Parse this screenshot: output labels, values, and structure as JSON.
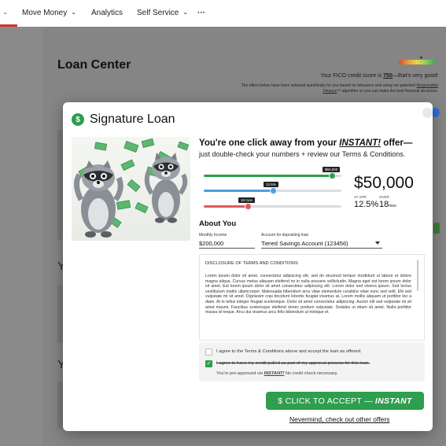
{
  "nav": {
    "items": [
      {
        "label": "Move Money"
      },
      {
        "label": "Analytics"
      },
      {
        "label": "Self Service"
      },
      {
        "label": "···"
      }
    ]
  },
  "background": {
    "page_title": "Loan Center",
    "fico_prefix": "Your FICO credit score is ",
    "fico_score": "750",
    "fico_suffix": "—that's very good!",
    "offer_note_1": "The offers below have been selected specifically for you based on relevance and using our",
    "offer_note_2": "patented",
    "offer_note_link": "Responsible Finance",
    "offer_note_3": "™ algorithm so you can make the best financial decisions.",
    "letter_1": "Y",
    "letter_2": "Y"
  },
  "modal": {
    "title": "Signature Loan",
    "headline_1": "You're one click away from your ",
    "headline_instant": "INSTANT!",
    "headline_2": " offer—",
    "subhead": "just double-check your numbers + review our Terms & Conditions.",
    "sliders": {
      "amount_tip": "$50,000",
      "apr_tip": "12.5%",
      "term_tip": "18 mos",
      "amount_level": 0.93,
      "apr_level": 0.5,
      "term_level": 0.32
    },
    "amount": "$50,000",
    "apr_label": "AT APR",
    "over_label": "OVER",
    "apr_value": "12.5%",
    "term_value": "18",
    "term_unit": "mos",
    "about_heading": "About You",
    "income_label": "Monthly Income",
    "income_value": "$200,000",
    "account_label": "Account for depositing loan",
    "account_value": "Tiered Savings Account (123456)",
    "terms_heading": "DISCLOSURE OF TERMS AND CONDITIONS",
    "terms_body": "Lorem ipsum dolor sit amet, consectetur adipiscing elit, sed do eiusmod tempor incididunt ut labore et dolore magna aliqua. Cursus metus aliquam eleifend mi in nulla posuere sollicitudin. Magna eget est lorem ipsum dolor sit amet. Est lorem ipsum dolor sit amet consectetur adipiscing elit. Lorem dolor sed viverra ipsum. Sed lectus vestibulum mattis ullamcorper. Malesuada bibendum arcu vitae elementum curabitur vitae nunc sed velit. Elit sed vulputate mi sit amet. Dignissim cras tincidunt lobortis feugiat vivamus at. Lorem mollis aliquam ut porttitor leo a diam. At in tellus integer feugiat scelerisque. Dolor sit amet consectetur adipiscing. Auctor elit sed vulputate mi sit amet mauris. Faucibus scelerisque eleifend donec pretium vulputate. Sodales ut etiam sit amet. Nulla porttitor massa id neque. Arcu dui vivamus arcu felis bibendum ut tristique et.",
    "agree_terms": "I agree to the Terms & Conditions above and accept the loan as offered.",
    "agree_credit": "I agree to have my credit pulled as part of my approval process for this loan.",
    "preapproved_1": "You're pre-approved via ",
    "preapproved_instant": "INSTANT!",
    "preapproved_2": " No credit check necessary.",
    "accept_label": "$ CLICK TO ACCEPT —",
    "accept_instant": "INSTANT",
    "nevermind": "Nevermind, check out other offers"
  },
  "colors": {
    "accent_green": "#2e9e4f",
    "slider_blue": "#4aa0e0",
    "slider_red": "#e05a5a"
  }
}
